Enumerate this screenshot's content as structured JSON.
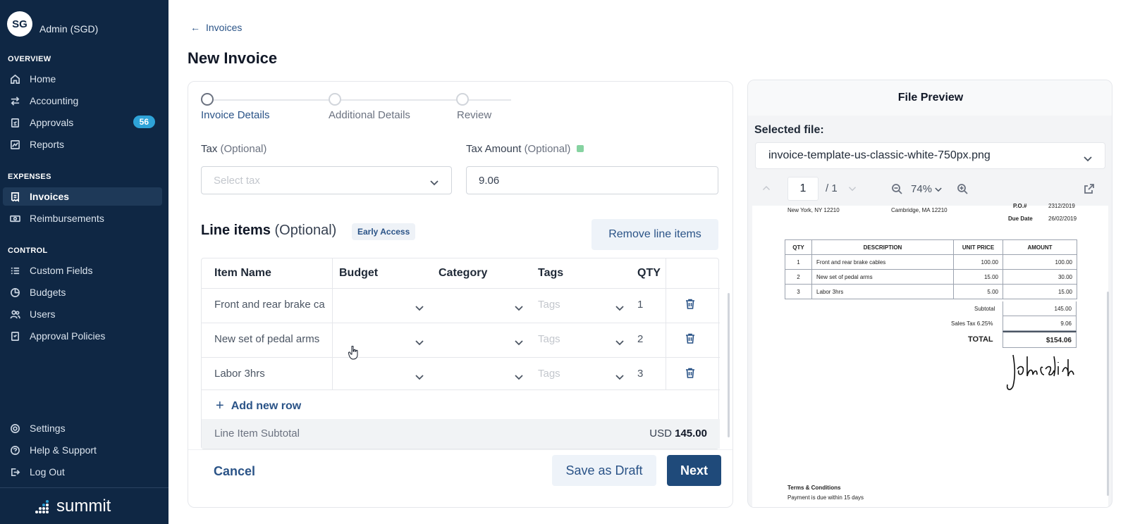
{
  "sidebar": {
    "avatar": "SG",
    "user_name": "Admin (SGD)",
    "sections": {
      "overview": "OVERVIEW",
      "expenses": "EXPENSES",
      "control": "CONTROL"
    },
    "items": {
      "home": "Home",
      "accounting": "Accounting",
      "approvals": "Approvals",
      "approvals_badge": "56",
      "reports": "Reports",
      "invoices": "Invoices",
      "reimbursements": "Reimbursements",
      "custom_fields": "Custom Fields",
      "budgets": "Budgets",
      "users": "Users",
      "approval_policies": "Approval Policies",
      "settings": "Settings",
      "help": "Help & Support",
      "logout": "Log Out"
    },
    "brand": "summit"
  },
  "header": {
    "back_label": "Invoices",
    "title": "New Invoice"
  },
  "stepper": {
    "steps": [
      "Invoice Details",
      "Additional Details",
      "Review"
    ],
    "active_index": 0
  },
  "form": {
    "tax_label": "Tax",
    "tax_optional": "(Optional)",
    "tax_placeholder": "Select tax",
    "tax_amount_label": "Tax Amount",
    "tax_amount_optional": "(Optional)",
    "tax_amount_value": "9.06"
  },
  "line_items": {
    "title": "Line items",
    "optional": "(Optional)",
    "badge": "Early Access",
    "remove_label": "Remove line items",
    "columns": [
      "Item Name",
      "Budget",
      "Category",
      "Tags",
      "QTY"
    ],
    "tags_placeholder": "Tags",
    "rows": [
      {
        "name": "Front and rear brake ca",
        "qty": "1"
      },
      {
        "name": "New set of pedal arms",
        "qty": "2"
      },
      {
        "name": "Labor 3hrs",
        "qty": "3"
      }
    ],
    "add_row_label": "Add new row",
    "subtotal_label": "Line Item Subtotal",
    "subtotal_currency": "USD",
    "subtotal_value": "145.00"
  },
  "footer": {
    "cancel": "Cancel",
    "save_draft": "Save as Draft",
    "next": "Next"
  },
  "preview": {
    "title": "File Preview",
    "selected_label": "Selected file:",
    "file_name": "invoice-template-us-classic-white-750px.png",
    "page_current": "1",
    "page_total": "/ 1",
    "zoom": "74%",
    "document": {
      "addr_left": "New York, NY 12210",
      "addr_mid": "Cambridge, MA 12210",
      "po_label": "P.O.#",
      "po_value": "2312/2019",
      "due_label": "Due Date",
      "due_value": "26/02/2019",
      "table_headers": [
        "QTY",
        "DESCRIPTION",
        "UNIT PRICE",
        "AMOUNT"
      ],
      "table_rows": [
        [
          "1",
          "Front and rear brake cables",
          "100.00",
          "100.00"
        ],
        [
          "2",
          "New set of pedal arms",
          "15.00",
          "30.00"
        ],
        [
          "3",
          "Labor 3hrs",
          "5.00",
          "15.00"
        ]
      ],
      "subtotal_label": "Subtotal",
      "subtotal_value": "145.00",
      "tax_label": "Sales Tax 6.25%",
      "tax_value": "9.06",
      "total_label": "TOTAL",
      "total_value": "$154.06",
      "signature": "John Smith",
      "terms_title": "Terms & Conditions",
      "terms_text": "Payment is due within 15 days"
    }
  }
}
